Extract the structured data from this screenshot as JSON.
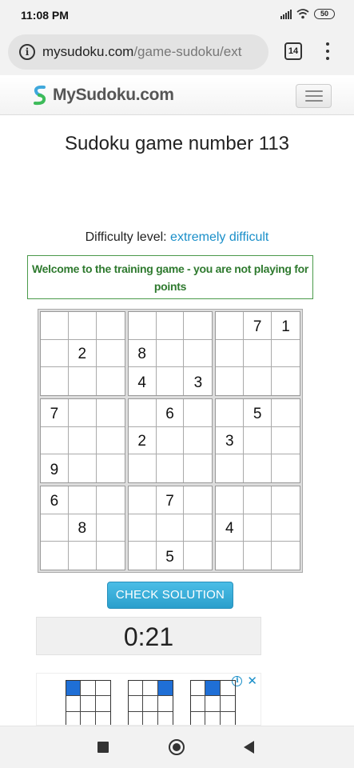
{
  "status_bar": {
    "time": "11:08 PM",
    "battery": "50",
    "icons": [
      "signal-icon",
      "wifi-icon",
      "battery-icon"
    ]
  },
  "browser": {
    "url_domain": "mysudoku.com",
    "url_path": "/game-sudoku/ext",
    "tab_count": "14",
    "icons": [
      "info-icon",
      "tabs-icon",
      "overflow-menu-icon"
    ]
  },
  "site": {
    "logo_text": "MySudoku.com",
    "menu_icon": "hamburger-icon"
  },
  "game": {
    "title": "Sudoku game number 113",
    "difficulty_label": "Difficulty level:",
    "difficulty_value": "extremely difficult",
    "welcome_message": "Welcome to the training game - you are not playing for points",
    "check_button": "CHECK SOLUTION",
    "timer": "0:21",
    "grid": [
      [
        "",
        "",
        "",
        "",
        "",
        "",
        "",
        "7",
        "1"
      ],
      [
        "",
        "2",
        "",
        "8",
        "",
        "",
        "",
        "",
        ""
      ],
      [
        "",
        "",
        "",
        "4",
        "",
        "3",
        "",
        "",
        ""
      ],
      [
        "7",
        "",
        "",
        "",
        "6",
        "",
        "",
        "5",
        ""
      ],
      [
        "",
        "",
        "",
        "2",
        "",
        "",
        "3",
        "",
        ""
      ],
      [
        "9",
        "",
        "",
        "",
        "",
        "",
        "",
        "",
        ""
      ],
      [
        "6",
        "",
        "",
        "",
        "7",
        "",
        "",
        "",
        ""
      ],
      [
        "",
        "8",
        "",
        "",
        "",
        "",
        "4",
        "",
        ""
      ],
      [
        "",
        "",
        "",
        "",
        "5",
        "",
        "",
        "",
        ""
      ]
    ]
  },
  "ad": {
    "icons": [
      "adchoices-icon",
      "close-icon"
    ],
    "mini_grids": [
      {
        "highlight": [
          0
        ]
      },
      {
        "highlight": [
          2
        ]
      },
      {
        "highlight": [
          1
        ]
      }
    ]
  },
  "nav_bar": {
    "icons": [
      "recents-icon",
      "home-icon",
      "back-icon"
    ]
  },
  "colors": {
    "link_blue": "#1a8fc9",
    "welcome_green": "#2f7a2f",
    "button_blue": "#2a9fcc",
    "ad_highlight": "#1f6fd6"
  }
}
